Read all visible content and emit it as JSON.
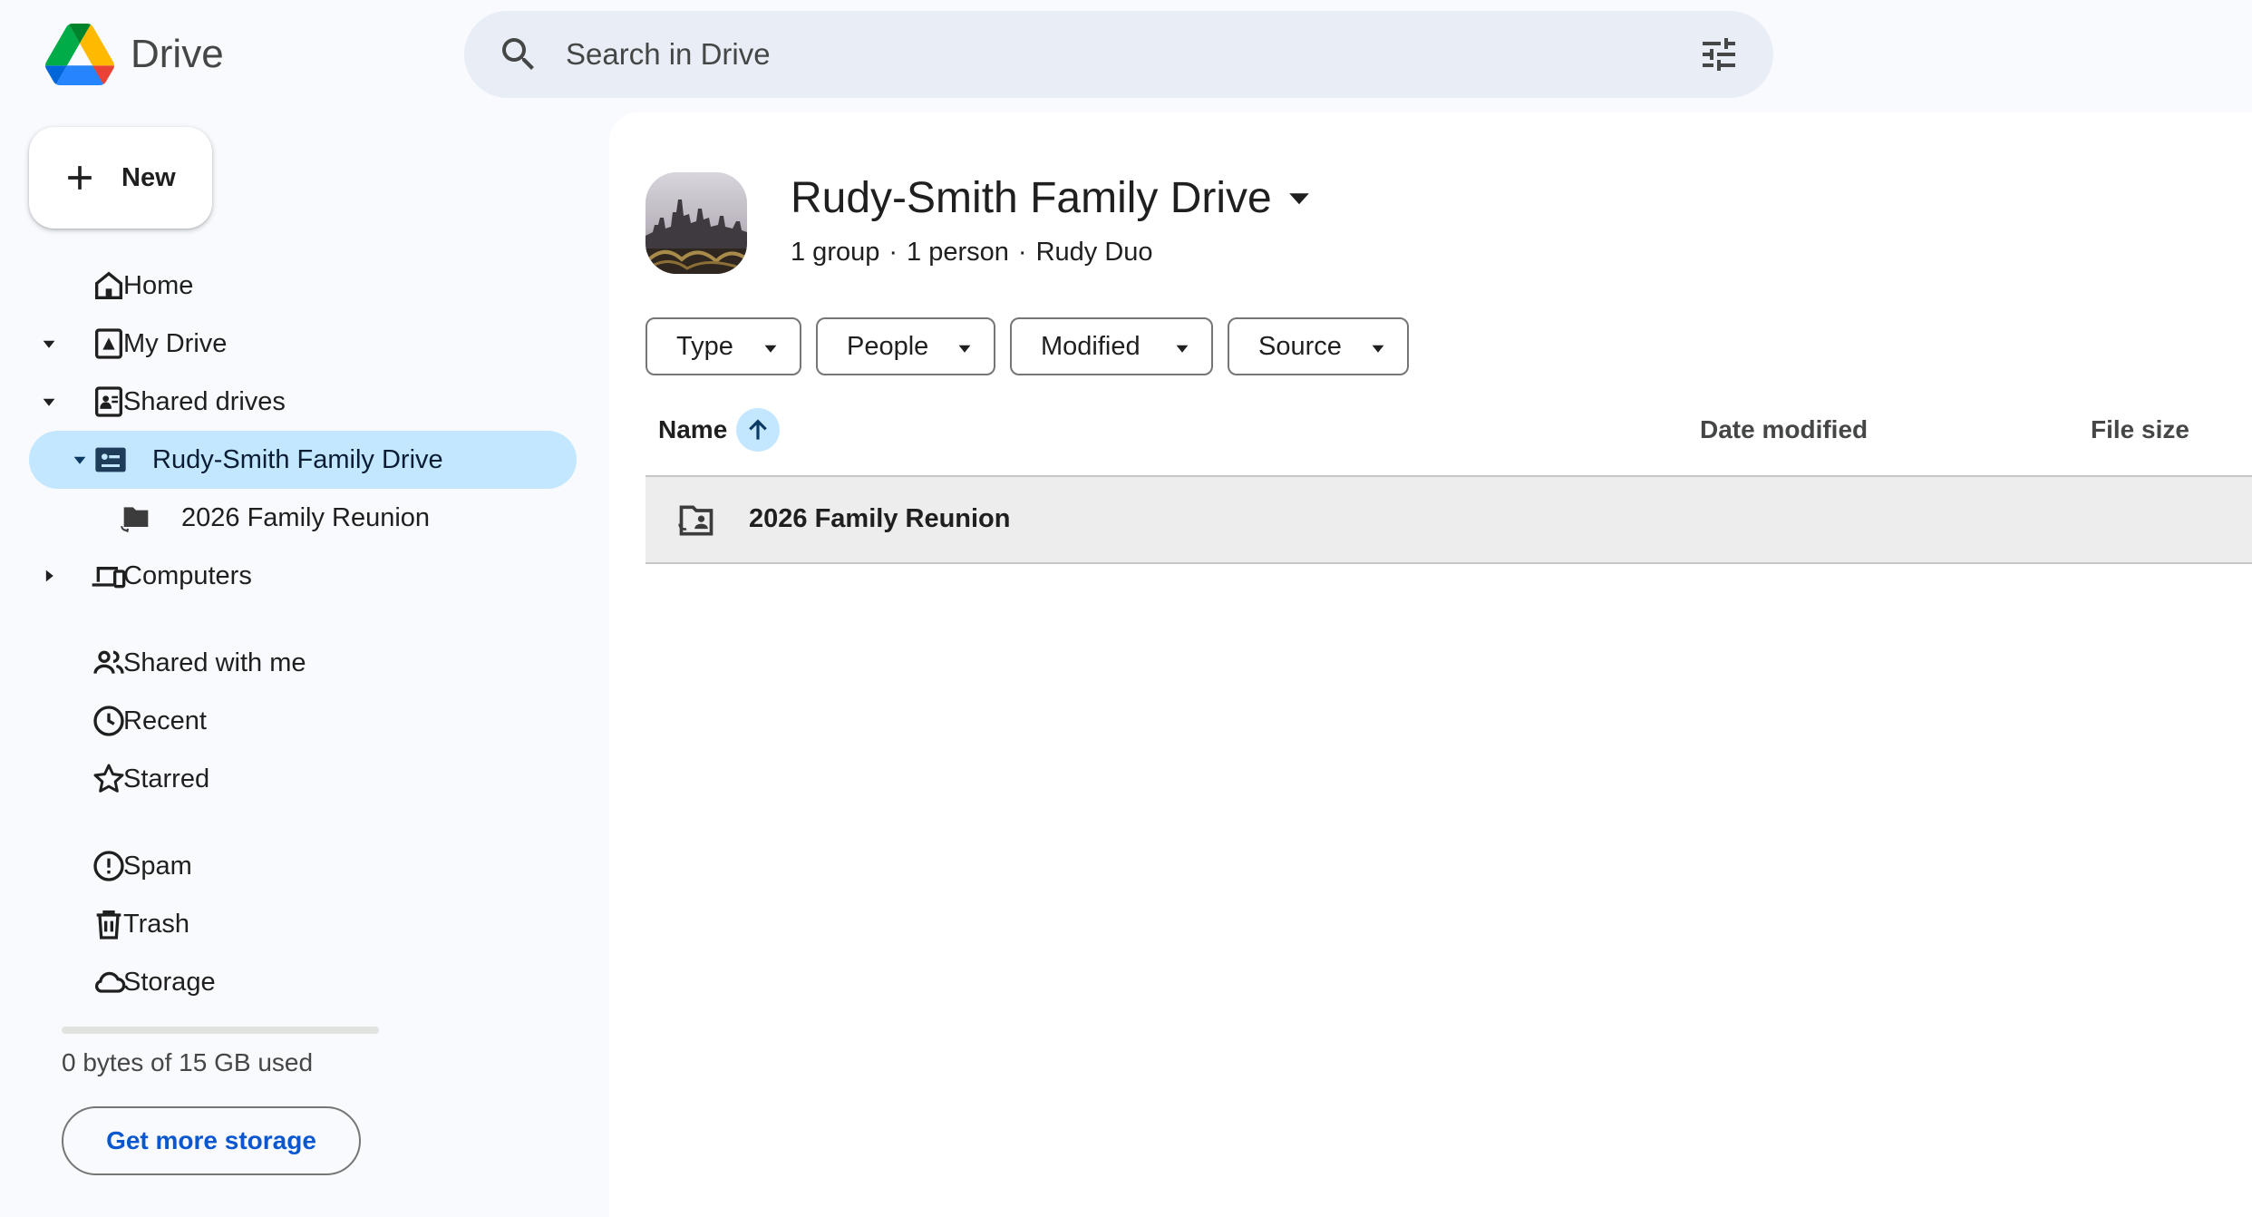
{
  "app": {
    "name": "Drive"
  },
  "search": {
    "placeholder": "Search in Drive"
  },
  "sidebar": {
    "new_label": "New",
    "items": [
      {
        "label": "Home",
        "icon": "home-icon"
      },
      {
        "label": "My Drive",
        "icon": "my-drive-icon"
      },
      {
        "label": "Shared drives",
        "icon": "shared-drives-icon"
      },
      {
        "label": "Rudy-Smith Family Drive",
        "icon": "shared-drive-icon",
        "active": true
      },
      {
        "label": "2026 Family Reunion",
        "icon": "shared-folder-icon"
      },
      {
        "label": "Computers",
        "icon": "computers-icon"
      },
      {
        "label": "Shared with me",
        "icon": "people-icon"
      },
      {
        "label": "Recent",
        "icon": "clock-icon"
      },
      {
        "label": "Starred",
        "icon": "star-icon"
      },
      {
        "label": "Spam",
        "icon": "spam-icon"
      },
      {
        "label": "Trash",
        "icon": "trash-icon"
      },
      {
        "label": "Storage",
        "icon": "cloud-icon"
      }
    ],
    "storage": {
      "used_fraction": 0,
      "text": "0 bytes of 15 GB used",
      "cta": "Get more storage"
    }
  },
  "main": {
    "drive_title": "Rudy-Smith Family Drive",
    "meta": {
      "groups": "1 group",
      "people": "1 person",
      "owner": "Rudy Duo"
    },
    "filters": [
      "Type",
      "People",
      "Modified",
      "Source"
    ],
    "columns": {
      "name": "Name",
      "date": "Date modified",
      "size": "File size"
    },
    "rows": [
      {
        "name": "2026 Family Reunion",
        "icon": "shared-folder-icon"
      }
    ]
  },
  "colors": {
    "accent": "#0b57d0",
    "active_bg": "#c2e7ff",
    "search_bg": "#e9eef6",
    "page_bg": "#f8fafd"
  }
}
